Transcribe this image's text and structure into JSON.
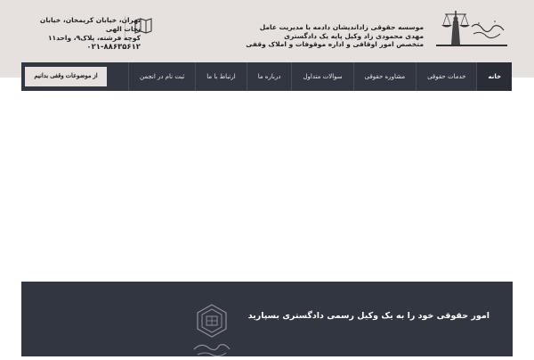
{
  "header": {
    "company_line1": "موسسه حقوقی زاداندیشان دادمه با مدیریت عامل",
    "company_line2": "مهدی محمودی زاد وکیل پایه یک دادگستری",
    "company_line3": "متخصص امور اوقافی و اداره موقوفات و املاک وقفی",
    "address_line1": "تهران، خیابان کریمخان، خیابان نجات الهی",
    "address_line2": "کوچه فرشته، پلاک۹، واحد۱۱",
    "phone": "۰۲۱-۸۸۶۳۵۶۱۲",
    "icons": [
      "scales-of-justice-logo",
      "map-icon"
    ]
  },
  "nav": {
    "items": [
      {
        "label": "خانه"
      },
      {
        "label": "خدمات حقوقی"
      },
      {
        "label": "مشاوره حقوقی"
      },
      {
        "label": "سوالات متداول"
      },
      {
        "label": "درباره ما"
      },
      {
        "label": "ارتباط با ما"
      },
      {
        "label": "ثبت نام در انجمن"
      }
    ],
    "cta_label": "از موضوعات وقفی بدانیم"
  },
  "banner": {
    "text": "امور حقوقی خود را به یک وکیل رسمی دادگستری بسپارید"
  },
  "colors": {
    "top_band": "#e6e0de",
    "nav_bg": "#323641",
    "text_dark": "#222222"
  }
}
